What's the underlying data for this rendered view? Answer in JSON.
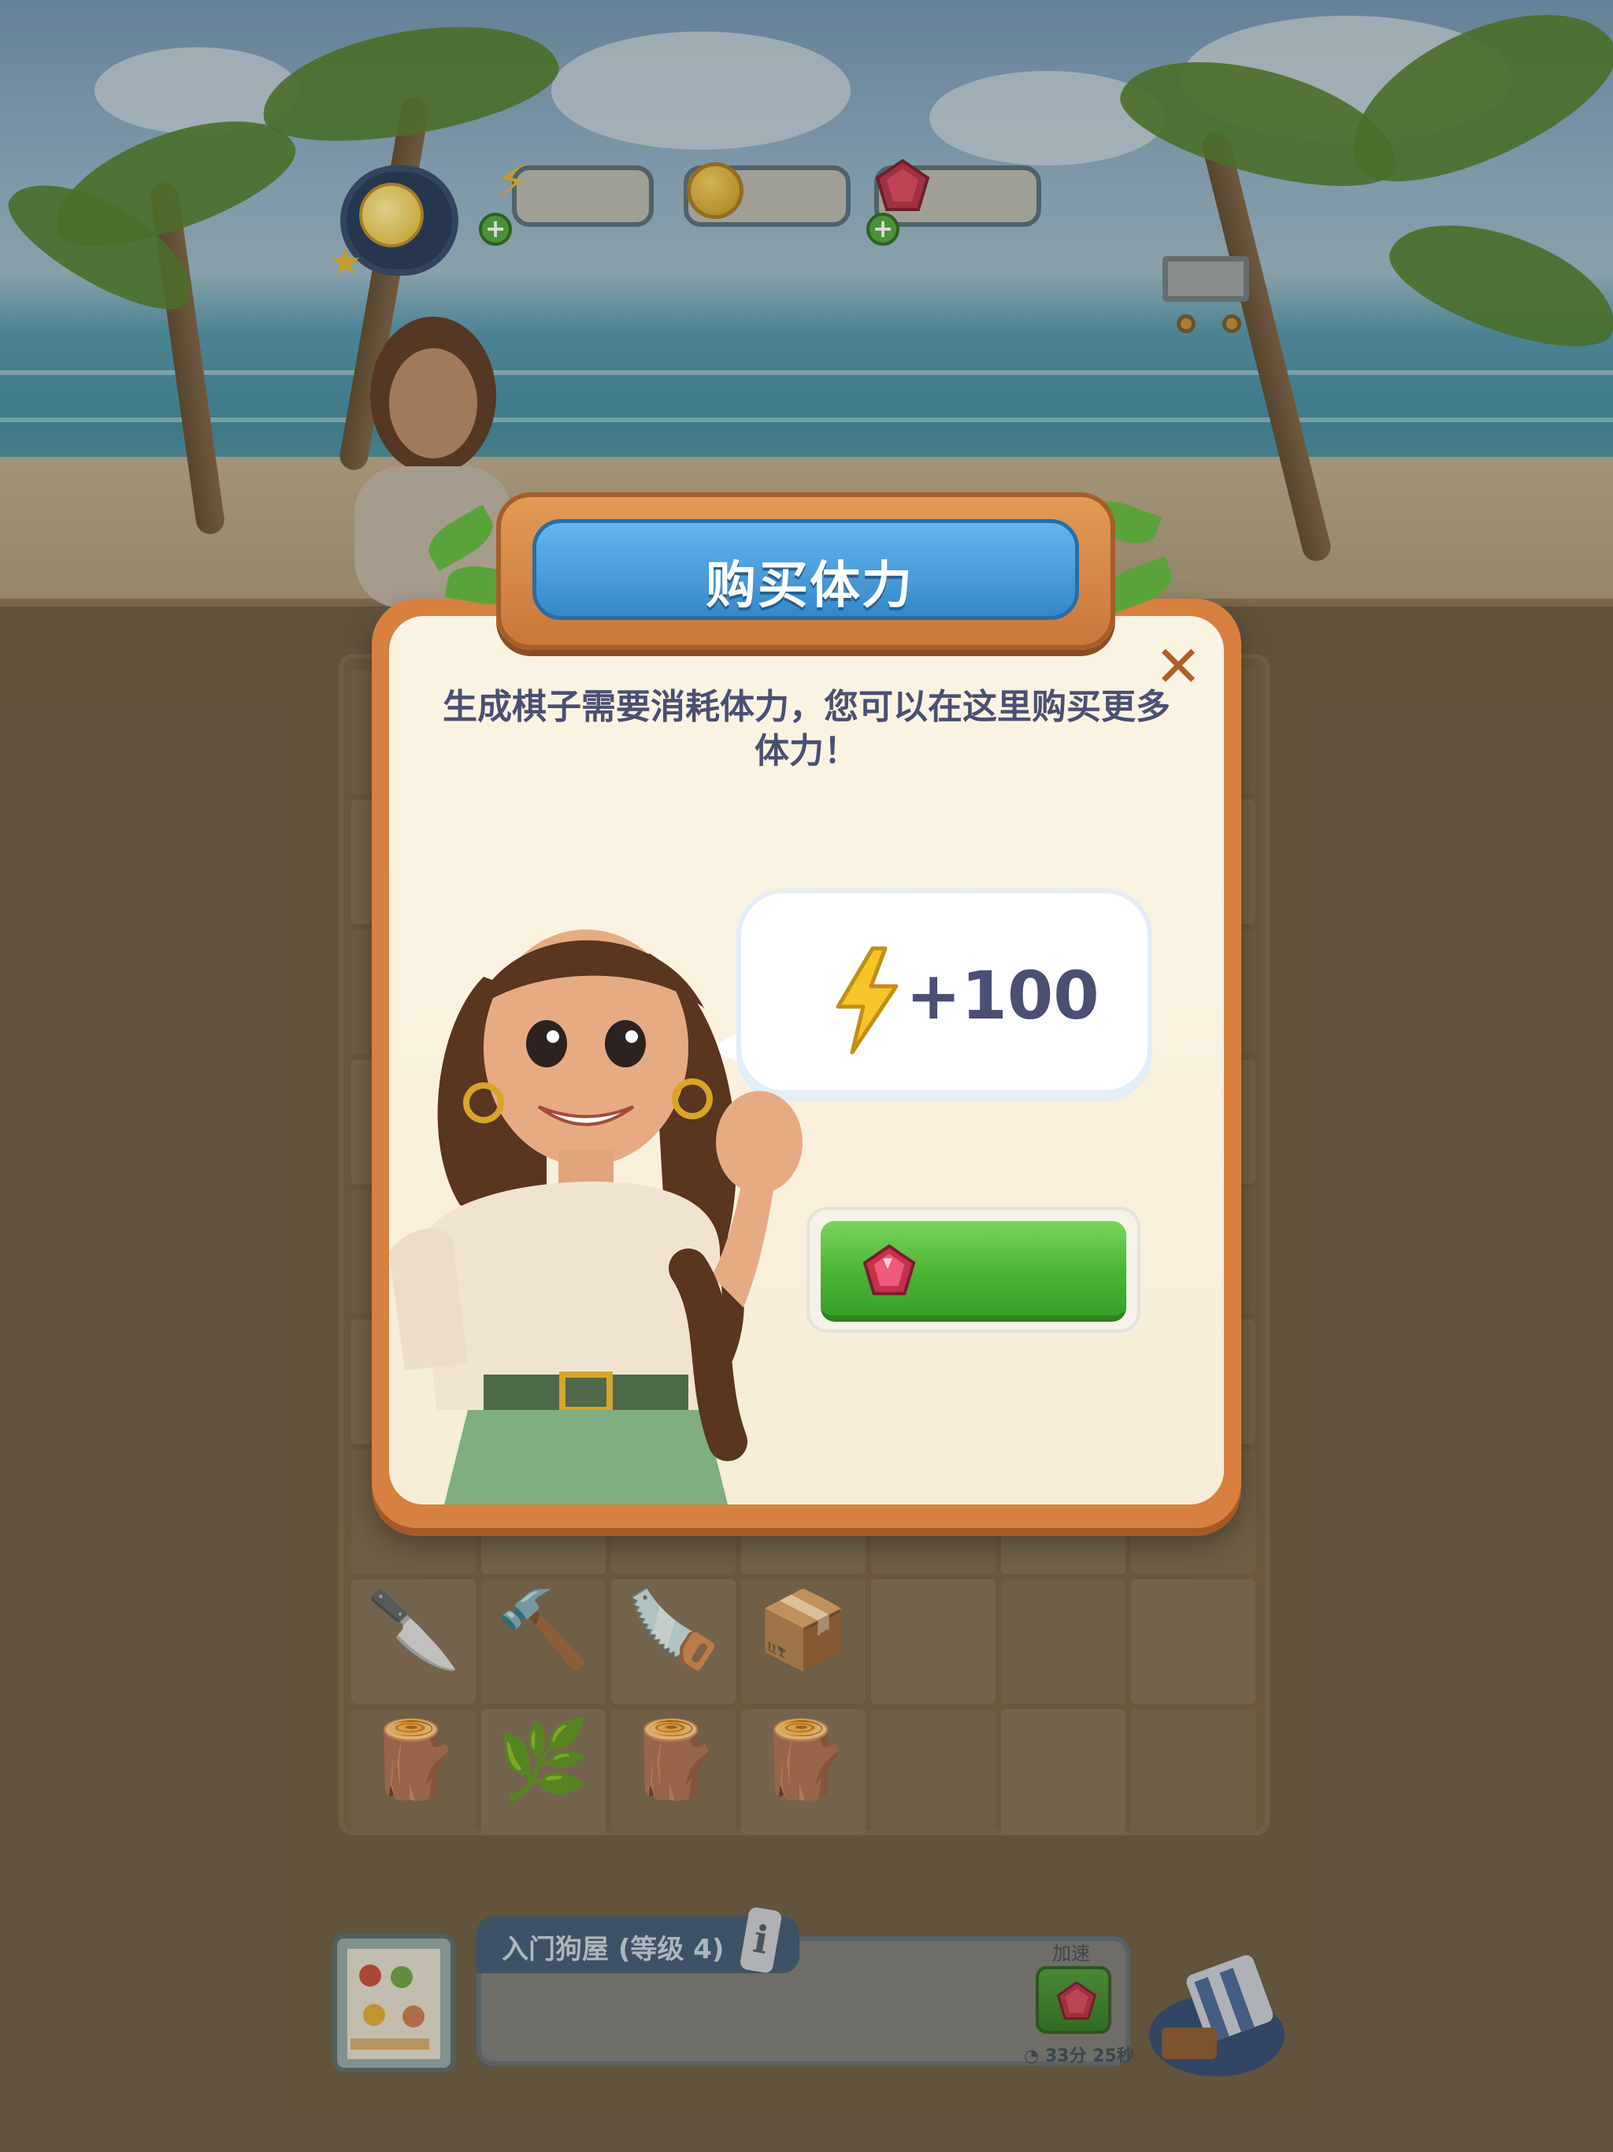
{
  "hud": {
    "level_icon": "sun-level-icon",
    "energy_value": "",
    "coin_value": "",
    "gem_value": "",
    "cart_icon": "shopping-cart-icon"
  },
  "board": {
    "rows": [
      [
        {
          "icon": "chisel-icon",
          "glyph": "🔪"
        },
        {
          "icon": "hammer-icon",
          "glyph": "🔨"
        },
        {
          "icon": "saw-icon",
          "glyph": "🪚"
        },
        {
          "icon": "crate-icon",
          "glyph": "📦"
        },
        null,
        null
      ],
      [
        {
          "icon": "wood-pile-icon",
          "glyph": "🪵"
        },
        {
          "icon": "branch-icon",
          "glyph": "🌿"
        },
        {
          "icon": "log-bundle-icon",
          "glyph": "🪵"
        },
        {
          "icon": "log-icon",
          "glyph": "🪵"
        },
        null,
        null
      ]
    ]
  },
  "quest": {
    "title": "入门狗屋 (等级 4)",
    "speed_label": "加速",
    "timer": "33分 25秒"
  },
  "dialog": {
    "title": "购买体力",
    "description": "生成棋子需要消耗体力，您可以在这里购买更多体力！",
    "reward_amount": "+100",
    "buy_price": ""
  },
  "colors": {
    "dialog_frame": "#d7803f",
    "title_plate": "#3588c9",
    "buy_button": "#4ab534",
    "text_dark": "#4b4f73"
  }
}
